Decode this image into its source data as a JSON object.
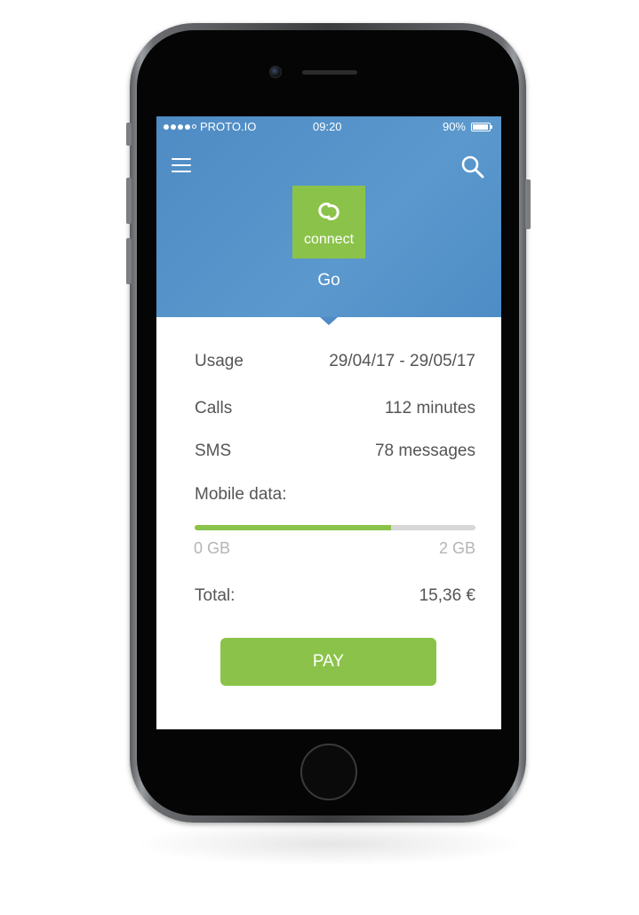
{
  "status_bar": {
    "carrier": "PROTO.IO",
    "time": "09:20",
    "battery": "90%"
  },
  "header": {
    "logo_text": "connect",
    "plan_name": "Go",
    "color": "#4f8bc4"
  },
  "usage": {
    "label": "Usage",
    "period": "29/04/17 - 29/05/17"
  },
  "calls": {
    "label": "Calls",
    "value": "112 minutes"
  },
  "sms": {
    "label": "SMS",
    "value": "78 messages"
  },
  "mobile_data": {
    "label": "Mobile data:",
    "min_label": "0 GB",
    "max_label": "2 GB",
    "used_fraction": 0.7
  },
  "total": {
    "label": "Total:",
    "value": "15,36 €"
  },
  "pay_button": {
    "label": "PAY",
    "color": "#8bc34a"
  },
  "icons": {
    "menu": "hamburger-menu-icon",
    "search": "search-icon",
    "logo": "connect-logo-icon"
  }
}
